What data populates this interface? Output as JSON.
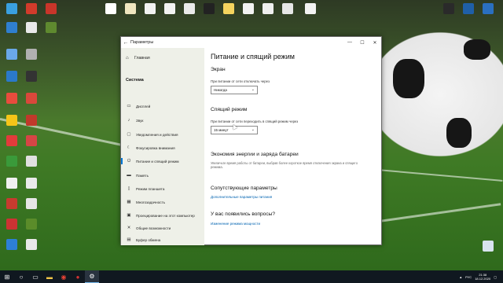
{
  "window": {
    "title": "Параметры",
    "back_icon": "back-arrow-icon",
    "minimize": "—",
    "maximize": "☐",
    "close": "✕"
  },
  "sidebar": {
    "home_label": "Главная",
    "section_heading": "Система",
    "items": [
      {
        "label": "Дисплей",
        "icon": "display-icon"
      },
      {
        "label": "Звук",
        "icon": "sound-icon"
      },
      {
        "label": "Уведомления и действия",
        "icon": "notifications-icon"
      },
      {
        "label": "Фокусировка внимания",
        "icon": "focus-icon"
      },
      {
        "label": "Питание и спящий режим",
        "icon": "power-icon",
        "active": true
      },
      {
        "label": "Память",
        "icon": "storage-icon"
      },
      {
        "label": "Режим планшета",
        "icon": "tablet-icon"
      },
      {
        "label": "Многозадачность",
        "icon": "multitasking-icon"
      },
      {
        "label": "Проецирование на этот компьютер",
        "icon": "projecting-icon"
      },
      {
        "label": "Общие возможности",
        "icon": "shared-experiences-icon"
      },
      {
        "label": "Буфер обмена",
        "icon": "clipboard-icon"
      },
      {
        "label": "Удаленный рабочий стол",
        "icon": "remote-desktop-icon"
      }
    ]
  },
  "content": {
    "page_title": "Питание и спящий режим",
    "screen": {
      "heading": "Экран",
      "label": "При питании от сети отключать через",
      "value": "Никогда"
    },
    "sleep": {
      "heading": "Спящий режим",
      "label": "При питании от сети переходить в спящий режим через",
      "value": "15 минут"
    },
    "battery": {
      "heading": "Экономия энергии и заряда батареи",
      "description": "Увеличьте время работы от батареи, выбрав более короткое время отключения экрана и спящего режима."
    },
    "related": {
      "heading": "Сопутствующие параметры",
      "link": "Дополнительные параметры питания"
    },
    "question": {
      "heading": "У вас появились вопросы?",
      "link": "Изменение режима мощности"
    }
  },
  "taskbar": {
    "time": "21:38",
    "date": "18.12.2020",
    "language": "РУС"
  },
  "colors": {
    "accent": "#0078d7",
    "link": "#0063b1",
    "taskbar": "#101820",
    "sidebar_bg": "#eef0e8"
  }
}
